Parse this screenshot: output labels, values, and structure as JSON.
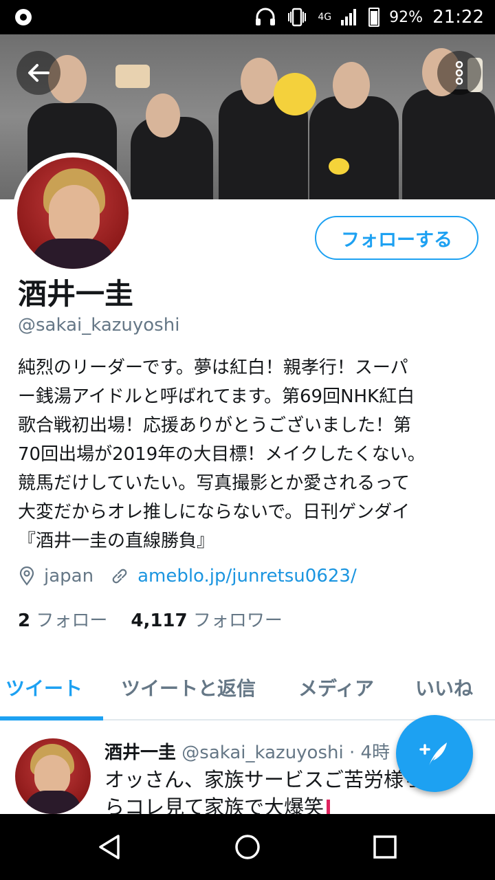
{
  "status_bar": {
    "network": "4G",
    "battery": "92%",
    "time": "21:22"
  },
  "profile": {
    "display_name": "酒井一圭",
    "handle": "@sakai_kazuyoshi",
    "follow_button": "フォローする",
    "bio_lines": [
      "純烈のリーダーです。夢は紅白！親孝行！スーパ",
      "ー銭湯アイドルと呼ばれてます。第69回NHK紅白",
      "歌合戦初出場！応援ありがとうございました！第",
      "70回出場が2019年の大目標！メイクしたくない。",
      "競馬だけしていたい。写真撮影とか愛されるって",
      "大変だからオレ推しにならないで。日刊ゲンダイ",
      "『酒井一圭の直線勝負』"
    ],
    "location": "japan",
    "website": "ameblo.jp/junretsu0623/",
    "following_count": "2",
    "following_label": "フォロー",
    "followers_count": "4,117",
    "followers_label": "フォロワー"
  },
  "tabs": [
    {
      "label": "ツイート",
      "active": true
    },
    {
      "label": "ツイートと返信",
      "active": false
    },
    {
      "label": "メディア",
      "active": false
    },
    {
      "label": "いいね",
      "active": false
    }
  ],
  "tweet": {
    "name": "酒井一圭",
    "handle": "@sakai_kazuyoshi",
    "separator": "·",
    "time": "4時",
    "line1": "オッさん、家族サービスご苦労様",
    "line1_tail": "ら",
    "line2": "らコレ見て家族で大爆笑"
  },
  "icons": {
    "back": "arrow-left-icon",
    "more": "more-vertical-icon",
    "location": "location-pin-icon",
    "link": "link-icon",
    "compose": "compose-tweet-icon",
    "nav_back": "nav-back-icon",
    "nav_home": "nav-home-icon",
    "nav_recents": "nav-recents-icon"
  },
  "colors": {
    "accent": "#1da1f2",
    "link": "#1b95e0",
    "secondary_text": "#657786"
  }
}
